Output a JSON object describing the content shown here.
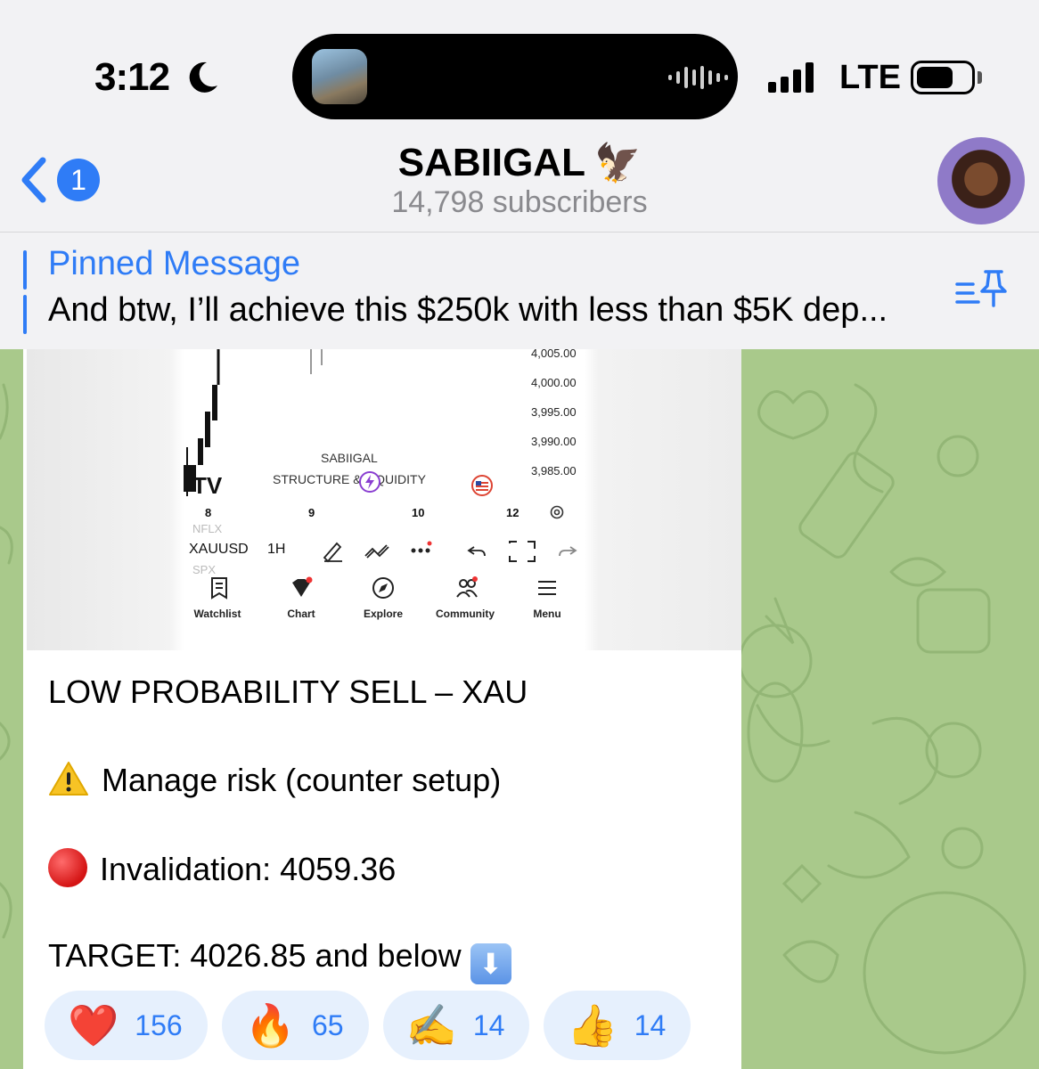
{
  "status_bar": {
    "time": "3:12",
    "network": "LTE"
  },
  "header": {
    "back_badge": "1",
    "channel_name": "SABIIGAL",
    "channel_emoji": "🦅",
    "subscribers": "14,798 subscribers"
  },
  "pinned": {
    "title": "Pinned Message",
    "text": "And btw, I’ll achieve this $250k with less than $5K dep..."
  },
  "media": {
    "prices": [
      "4,005.00",
      "4,000.00",
      "3,995.00",
      "3,990.00",
      "3,985.00"
    ],
    "watermark_name": "SABIIGAL",
    "watermark_sub": "STRUCTURE & LIQUIDITY",
    "x_ticks": [
      "8",
      "9",
      "10",
      "12"
    ],
    "symbol": "XAUUSD",
    "timeframe": "1H",
    "ghost_top": "NFLX",
    "ghost_bottom": "SPX",
    "nav": [
      "Watchlist",
      "Chart",
      "Explore",
      "Community",
      "Menu"
    ]
  },
  "message": {
    "line1": "LOW PROBABILITY SELL – XAU",
    "line2": "Manage risk (counter setup)",
    "line3": "Invalidation: 4059.36",
    "line4": "TARGET: 4026.85 and below"
  },
  "reactions": [
    {
      "emoji": "❤️",
      "count": "156"
    },
    {
      "emoji": "🔥",
      "count": "65"
    },
    {
      "emoji": "✍️",
      "count": "14"
    },
    {
      "emoji": "👍",
      "count": "14"
    }
  ],
  "colors": {
    "accent": "#2f7cf6",
    "chat_bg": "#a9c98b",
    "reaction_bg": "#e6f0fd"
  }
}
